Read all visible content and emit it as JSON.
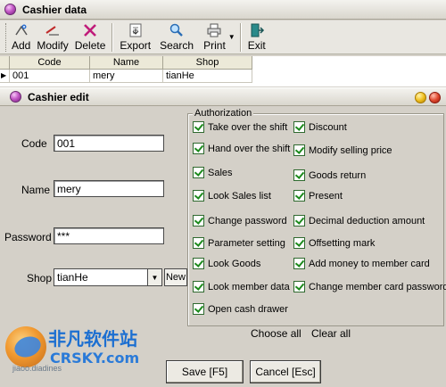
{
  "window": {
    "title": "Cashier data"
  },
  "toolbar": {
    "add": "Add",
    "modify": "Modify",
    "delete": "Delete",
    "export": "Export",
    "search": "Search",
    "print": "Print",
    "exit": "Exit"
  },
  "grid": {
    "columns": [
      "Code",
      "Name",
      "Shop"
    ],
    "rows": [
      {
        "code": "001",
        "name": "mery",
        "shop": "tianHe"
      }
    ]
  },
  "dialog": {
    "title": "Cashier edit",
    "code_label": "Code",
    "code_value": "001",
    "name_label": "Name",
    "name_value": "mery",
    "password_label": "Password",
    "password_value": "***",
    "shop_label": "Shop",
    "shop_value": "tianHe",
    "new_button": "New",
    "authorization": {
      "caption": "Authorization",
      "left": [
        "Take over the shift",
        "Hand over the shift",
        "Sales",
        "Look Sales list",
        "Change password",
        "Parameter setting",
        "Look Goods",
        "Look member data",
        "Open cash drawer"
      ],
      "right": [
        "Discount",
        "Modify selling price",
        "Goods return",
        "Present",
        "Decimal deduction amount",
        "Offsetting mark",
        "Add money to member card",
        "Change member card password"
      ]
    },
    "choose_all": "Choose all",
    "clear_all": "Clear all",
    "save": "Save [F5]",
    "cancel": "Cancel [Esc]"
  },
  "watermark": {
    "cn": "非凡软件站",
    "en": "CRSKY.com",
    "small": "jiaoo.diadines"
  },
  "colors": {
    "check": "#1c8a1c",
    "watermark": "#1c6fd1"
  }
}
